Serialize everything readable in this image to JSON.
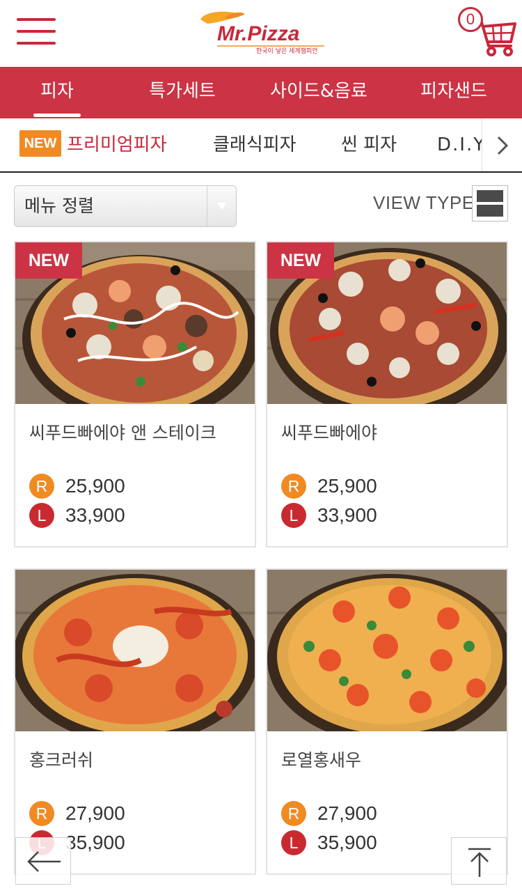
{
  "header": {
    "logo_text": "Mr.Pizza",
    "logo_tagline": "한국이 낳은 세계챔피언",
    "cart_count": "0"
  },
  "main_tabs": [
    {
      "label": "피자",
      "active": true
    },
    {
      "label": "특가세트",
      "active": false
    },
    {
      "label": "사이드&음료",
      "active": false
    },
    {
      "label": "피자샌드",
      "active": false
    }
  ],
  "sub_tabs": [
    {
      "label": "프리미엄피자",
      "badge": "NEW",
      "active": true
    },
    {
      "label": "클래식피자",
      "active": false
    },
    {
      "label": "씬 피자",
      "active": false
    },
    {
      "label": "D.I.Y",
      "active": false
    }
  ],
  "sort": {
    "label": "메뉴 정렬"
  },
  "view_type": {
    "label": "VIEW TYPE"
  },
  "products": [
    {
      "name": "씨푸드빠에야 앤 스테이크",
      "badge": "NEW",
      "r_label": "R",
      "r_price": "25,900",
      "l_label": "L",
      "l_price": "33,900"
    },
    {
      "name": "씨푸드빠에야",
      "badge": "NEW",
      "r_label": "R",
      "r_price": "25,900",
      "l_label": "L",
      "l_price": "33,900"
    },
    {
      "name": "홍크러쉬",
      "badge": "",
      "r_label": "R",
      "r_price": "27,900",
      "l_label": "L",
      "l_price": "35,900"
    },
    {
      "name": "로열홍새우",
      "badge": "",
      "r_label": "R",
      "r_price": "27,900",
      "l_label": "L",
      "l_price": "35,900"
    }
  ],
  "colors": {
    "brand_red": "#cc3344",
    "orange": "#f08a22",
    "price_l": "#c82a30"
  }
}
